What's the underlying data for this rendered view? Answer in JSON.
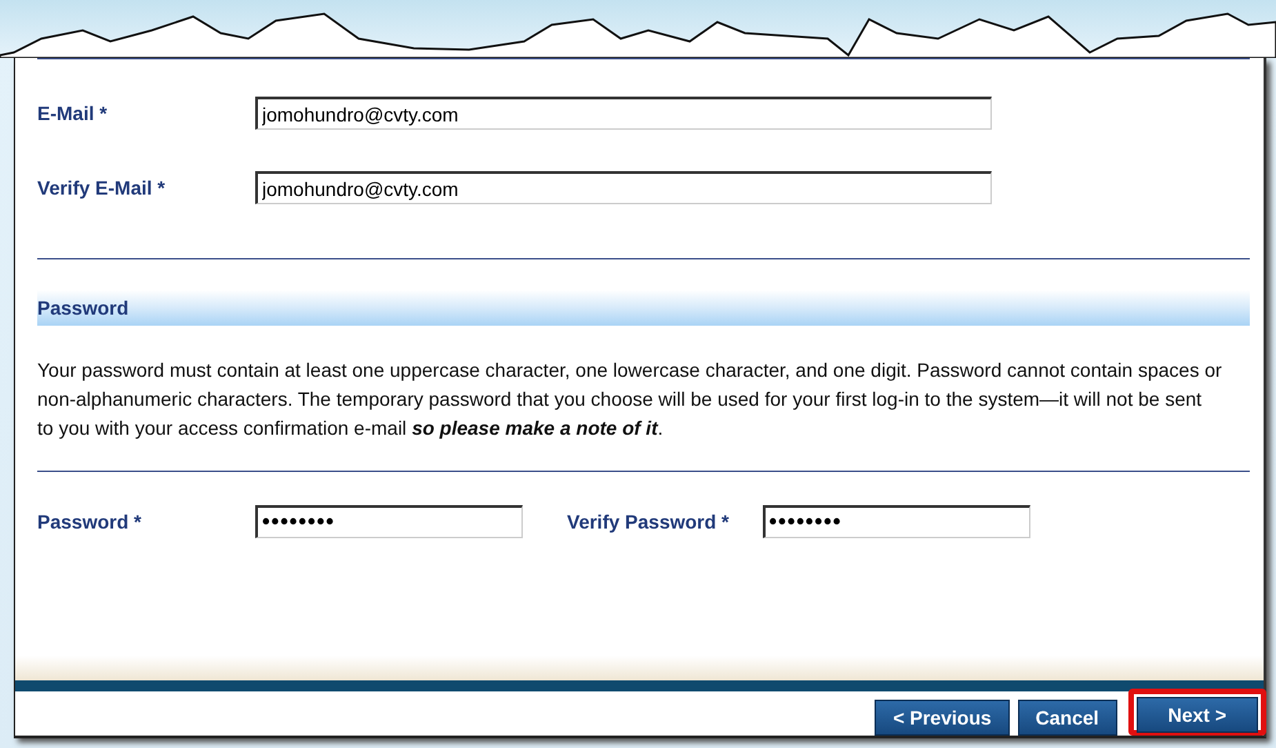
{
  "email_fields": [
    {
      "label": "E-Mail *",
      "value": "jomohundro@cvty.com"
    },
    {
      "label": "Verify E-Mail *",
      "value": "jomohundro@cvty.com"
    }
  ],
  "password_section": {
    "title": "Password",
    "description": "Your password must contain at least one uppercase character, one lowercase character, and one digit. Password cannot contain spaces or non-alphanumeric characters. The temporary password that you choose will be used for your first log-in to the system—it will not be sent to you with your access confirmation e-mail **so please make a note of it**."
  },
  "password_fields": [
    {
      "label": "Password *",
      "value": "••••••••"
    },
    {
      "label": "Verify Password *",
      "value": "••••••••"
    }
  ],
  "buttons": [
    {
      "label": "< Previous",
      "highlighted": false
    },
    {
      "label": "Cancel",
      "highlighted": false
    },
    {
      "label": "Next >",
      "highlighted": true
    }
  ]
}
